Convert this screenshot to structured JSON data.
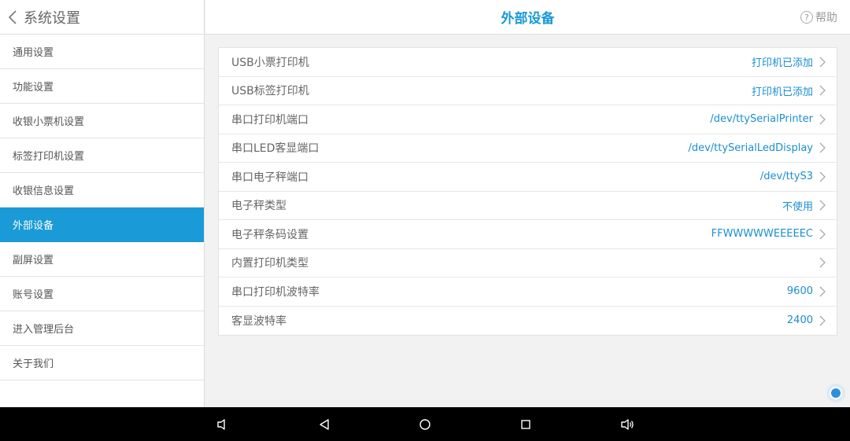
{
  "sidebar": {
    "title": "系统设置",
    "back_icon": "chevron-left-icon",
    "items": [
      {
        "label": "通用设置",
        "active": false
      },
      {
        "label": "功能设置",
        "active": false
      },
      {
        "label": "收银小票机设置",
        "active": false
      },
      {
        "label": "标签打印机设置",
        "active": false
      },
      {
        "label": "收银信息设置",
        "active": false
      },
      {
        "label": "外部设备",
        "active": true
      },
      {
        "label": "副屏设置",
        "active": false
      },
      {
        "label": "账号设置",
        "active": false
      },
      {
        "label": "进入管理后台",
        "active": false
      },
      {
        "label": "关于我们",
        "active": false
      }
    ]
  },
  "header": {
    "title": "外部设备",
    "help_label": "帮助",
    "help_icon_glyph": "?"
  },
  "settings": [
    {
      "label": "USB小票打印机",
      "value": "打印机已添加"
    },
    {
      "label": "USB标签打印机",
      "value": "打印机已添加"
    },
    {
      "label": "串口打印机端口",
      "value": "/dev/ttySerialPrinter"
    },
    {
      "label": "串口LED客显端口",
      "value": "/dev/ttySerialLedDisplay"
    },
    {
      "label": "串口电子秤端口",
      "value": "/dev/ttyS3"
    },
    {
      "label": "电子秤类型",
      "value": "不使用"
    },
    {
      "label": "电子秤条码设置",
      "value": "FFWWWWWEEEEEC"
    },
    {
      "label": "内置打印机类型",
      "value": ""
    },
    {
      "label": "串口打印机波特率",
      "value": "9600"
    },
    {
      "label": "客显波特率",
      "value": "2400"
    }
  ],
  "colors": {
    "accent": "#1a9ad6",
    "value_text": "#1a8fcf",
    "nav_bar": "#000000"
  },
  "nav_bar": {
    "icons": [
      "volume-down-icon",
      "back-triangle-icon",
      "home-circle-icon",
      "recents-square-icon",
      "volume-up-icon"
    ]
  }
}
